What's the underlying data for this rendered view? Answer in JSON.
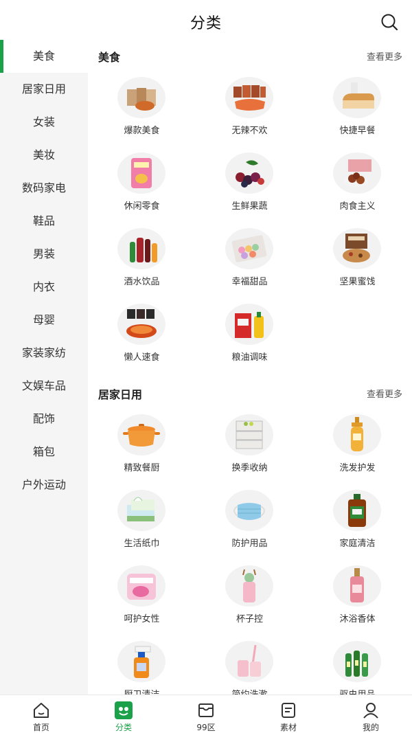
{
  "header": {
    "title": "分类",
    "search_icon": "search-icon"
  },
  "sidebar": {
    "active_index": 0,
    "accent_color": "#1aa14a",
    "items": [
      {
        "label": "美食"
      },
      {
        "label": "居家日用"
      },
      {
        "label": "女装"
      },
      {
        "label": "美妆"
      },
      {
        "label": "数码家电"
      },
      {
        "label": "鞋品"
      },
      {
        "label": "男装"
      },
      {
        "label": "内衣"
      },
      {
        "label": "母婴"
      },
      {
        "label": "家装家纺"
      },
      {
        "label": "文娱车品"
      },
      {
        "label": "配饰"
      },
      {
        "label": "箱包"
      },
      {
        "label": "户外运动"
      }
    ]
  },
  "sections": [
    {
      "title": "美食",
      "more": "查看更多",
      "items": [
        {
          "label": "爆款美食",
          "icon": "snack-box-icon"
        },
        {
          "label": "无辣不欢",
          "icon": "spicy-food-icon"
        },
        {
          "label": "快捷早餐",
          "icon": "bread-icon"
        },
        {
          "label": "休闲零食",
          "icon": "chips-bag-icon"
        },
        {
          "label": "生鲜果蔬",
          "icon": "berries-icon"
        },
        {
          "label": "肉食主义",
          "icon": "meat-icon"
        },
        {
          "label": "酒水饮品",
          "icon": "drinks-icon"
        },
        {
          "label": "幸福甜品",
          "icon": "macaron-icon"
        },
        {
          "label": "坚果蜜饯",
          "icon": "nuts-icon"
        },
        {
          "label": "懒人速食",
          "icon": "instant-noodle-icon"
        },
        {
          "label": "粮油调味",
          "icon": "rice-oil-icon"
        }
      ]
    },
    {
      "title": "居家日用",
      "more": "查看更多",
      "items": [
        {
          "label": "精致餐厨",
          "icon": "pot-icon"
        },
        {
          "label": "换季收纳",
          "icon": "storage-box-icon"
        },
        {
          "label": "洗发护发",
          "icon": "shampoo-icon"
        },
        {
          "label": "生活纸巾",
          "icon": "tissue-icon"
        },
        {
          "label": "防护用品",
          "icon": "mask-icon"
        },
        {
          "label": "家庭清洁",
          "icon": "disinfectant-icon"
        },
        {
          "label": "呵护女性",
          "icon": "sanitary-pad-icon"
        },
        {
          "label": "杯子控",
          "icon": "cup-icon"
        },
        {
          "label": "沐浴香体",
          "icon": "body-mist-icon"
        },
        {
          "label": "厨卫清洁",
          "icon": "spray-bottle-icon"
        },
        {
          "label": "简约洗漱",
          "icon": "toothbrush-cup-icon"
        },
        {
          "label": "驱虫用品",
          "icon": "bottles-icon"
        }
      ]
    }
  ],
  "tabbar": {
    "active_index": 1,
    "items": [
      {
        "label": "首页",
        "icon": "home-icon"
      },
      {
        "label": "分类",
        "icon": "category-icon"
      },
      {
        "label": "99区",
        "icon": "inbox-icon"
      },
      {
        "label": "素材",
        "icon": "document-icon"
      },
      {
        "label": "我的",
        "icon": "user-icon"
      }
    ]
  }
}
